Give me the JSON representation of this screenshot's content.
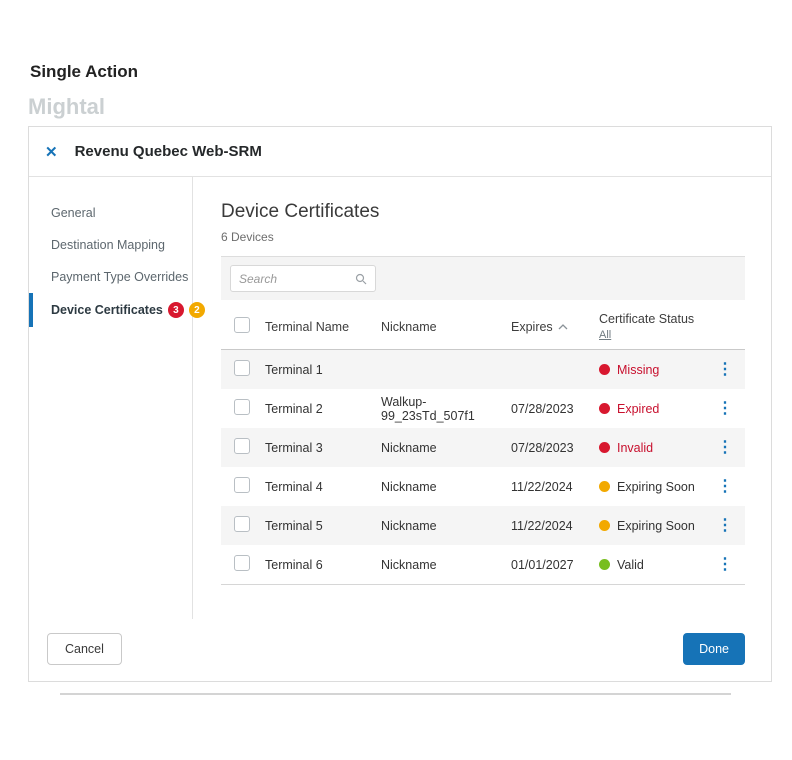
{
  "page": {
    "title": "Single Action",
    "brand": "Mightal"
  },
  "modal": {
    "title": "Revenu Quebec Web-SRM"
  },
  "sidebar": {
    "items": [
      {
        "label": "General",
        "active": false,
        "badges": []
      },
      {
        "label": "Destination Mapping",
        "active": false,
        "badges": []
      },
      {
        "label": "Payment Type Overrides",
        "active": false,
        "badges": []
      },
      {
        "label": "Device Certificates",
        "active": true,
        "badges": [
          {
            "value": "3",
            "color": "#d8182f"
          },
          {
            "value": "2",
            "color": "#f2a900"
          }
        ]
      }
    ]
  },
  "content": {
    "heading": "Device Certificates",
    "device_count": "6 Devices",
    "search": {
      "placeholder": "Search"
    },
    "table": {
      "headers": {
        "terminal": "Terminal Name",
        "nickname": "Nickname",
        "expires": "Expires",
        "status": "Certificate Status",
        "status_filter": "All"
      },
      "rows": [
        {
          "terminal": "Terminal 1",
          "nickname": "",
          "expires": "",
          "status": "Missing",
          "status_kind": "error"
        },
        {
          "terminal": "Terminal 2",
          "nickname": "Walkup-99_23sTd_507f1",
          "expires": "07/28/2023",
          "status": "Expired",
          "status_kind": "error"
        },
        {
          "terminal": "Terminal 3",
          "nickname": "Nickname",
          "expires": "07/28/2023",
          "status": "Invalid",
          "status_kind": "error"
        },
        {
          "terminal": "Terminal 4",
          "nickname": "Nickname",
          "expires": "11/22/2024",
          "status": "Expiring Soon",
          "status_kind": "warning"
        },
        {
          "terminal": "Terminal 5",
          "nickname": "Nickname",
          "expires": "11/22/2024",
          "status": "Expiring Soon",
          "status_kind": "warning"
        },
        {
          "terminal": "Terminal 6",
          "nickname": "Nickname",
          "expires": "01/01/2027",
          "status": "Valid",
          "status_kind": "success"
        }
      ]
    }
  },
  "footer": {
    "cancel": "Cancel",
    "done": "Done"
  },
  "colors": {
    "accent_blue": "#1673b7",
    "error_red": "#d8182f",
    "warning_yellow": "#f2a900",
    "success_green": "#78be20",
    "error_text": "#c8102e"
  }
}
